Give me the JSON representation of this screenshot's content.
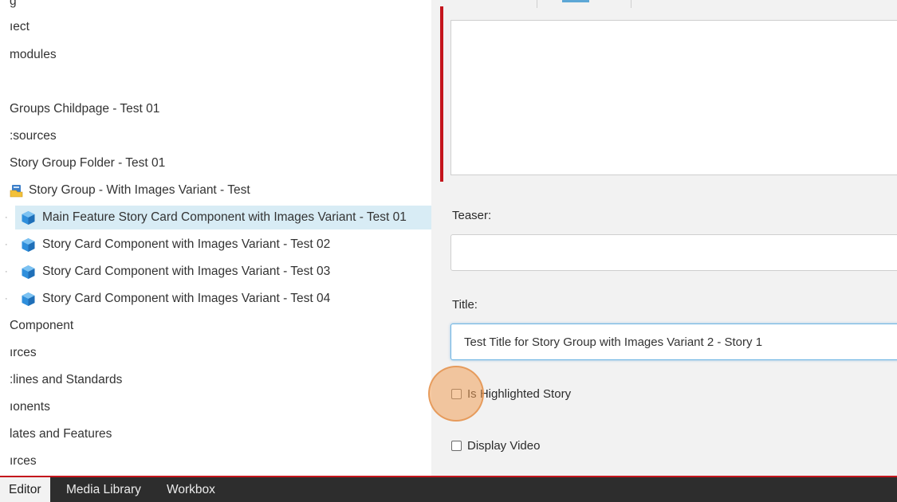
{
  "tree": {
    "items": [
      {
        "label": "g",
        "icon": "",
        "selected": false
      },
      {
        "label": "ıect",
        "icon": "",
        "selected": false
      },
      {
        "label": "modules",
        "icon": "",
        "selected": false
      },
      {
        "label": "Groups Childpage - Test 01",
        "icon": "",
        "selected": false
      },
      {
        "label": ":sources",
        "icon": "",
        "selected": false
      },
      {
        "label": "Story Group Folder - Test 01",
        "icon": "",
        "selected": false
      },
      {
        "label": "Story Group - With Images Variant - Test",
        "icon": "folder-icon",
        "selected": false
      },
      {
        "label": "Main Feature Story Card Component with Images Variant - Test 01",
        "icon": "cube-icon",
        "selected": true
      },
      {
        "label": "Story Card Component with Images Variant - Test 02",
        "icon": "cube-icon",
        "selected": false
      },
      {
        "label": "Story Card Component with Images Variant - Test 03",
        "icon": "cube-icon",
        "selected": false
      },
      {
        "label": "Story Card Component with Images Variant - Test 04",
        "icon": "cube-icon",
        "selected": false
      },
      {
        "label": "Component",
        "icon": "",
        "selected": false
      },
      {
        "label": "ırces",
        "icon": "",
        "selected": false
      },
      {
        "label": ":lines and Standards",
        "icon": "",
        "selected": false
      },
      {
        "label": "ıonents",
        "icon": "",
        "selected": false
      },
      {
        "label": "lates and Features",
        "icon": "",
        "selected": false
      },
      {
        "label": "ırces",
        "icon": "",
        "selected": false
      }
    ]
  },
  "form": {
    "teaser_label": "Teaser:",
    "teaser_value": "",
    "title_label": "Title:",
    "title_value": "Test Title for Story Group with Images Variant 2 - Story 1",
    "highlighted_label": "Is Highlighted Story",
    "highlighted_checked": false,
    "video_label": "Display Video",
    "video_checked": false
  },
  "bottom_tabs": [
    {
      "label": "Editor",
      "active": true
    },
    {
      "label": "Media Library",
      "active": false
    },
    {
      "label": "Workbox",
      "active": false
    }
  ],
  "colors": {
    "accent_red": "#c4151c",
    "selection": "#d8ecf5",
    "cube_blue": "#2f8fdc",
    "bottom_bar": "#2d2d2d",
    "click_highlight": "#f0a05a"
  }
}
